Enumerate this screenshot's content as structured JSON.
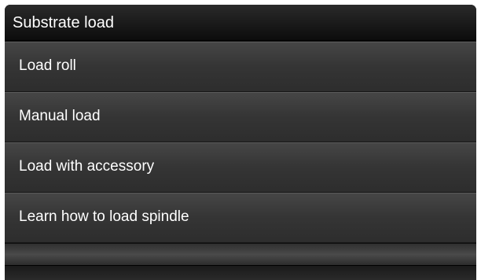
{
  "header": {
    "title": "Substrate load"
  },
  "menu": {
    "items": [
      {
        "label": "Load roll"
      },
      {
        "label": "Manual load"
      },
      {
        "label": "Load with accessory"
      },
      {
        "label": "Learn how to load spindle"
      }
    ]
  },
  "colors": {
    "background": "#161616",
    "text": "#ffffff",
    "item": "#3a3a3a"
  }
}
